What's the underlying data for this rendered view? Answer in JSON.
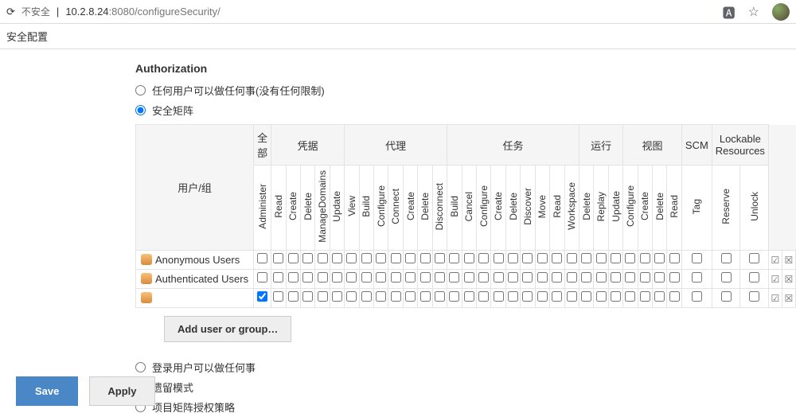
{
  "urlbar": {
    "insecure_label": "不安全",
    "host": "10.2.8.24",
    "port_path": ":8080/configureSecurity/"
  },
  "breadcrumb": {
    "page": "安全配置"
  },
  "section": {
    "authorization": "Authorization"
  },
  "auth_radios": {
    "anyone": "任何用户可以做任何事(没有任何限制)",
    "matrix": "安全矩阵",
    "logged_in": "登录用户可以做任何事",
    "legacy": "遗留模式",
    "project": "项目矩阵授权策略"
  },
  "matrix": {
    "corner_label": "用户/组",
    "groups": [
      "全部",
      "凭据",
      "代理",
      "任务",
      "运行",
      "视图",
      "SCM",
      "Lockable Resources"
    ],
    "group_spans": [
      1,
      5,
      7,
      9,
      3,
      4,
      1,
      2
    ],
    "permissions": [
      "Administer",
      "Read",
      "Create",
      "Delete",
      "ManageDomains",
      "Update",
      "View",
      "Build",
      "Configure",
      "Connect",
      "Create",
      "Delete",
      "Disconnect",
      "Build",
      "Cancel",
      "Configure",
      "Create",
      "Delete",
      "Discover",
      "Move",
      "Read",
      "Workspace",
      "Delete",
      "Replay",
      "Update",
      "Configure",
      "Create",
      "Delete",
      "Read",
      "Tag",
      "Reserve",
      "Unlock"
    ],
    "rows": [
      {
        "label": "Anonymous Users",
        "checked": []
      },
      {
        "label": "Authenticated Users",
        "checked": []
      },
      {
        "label": "",
        "checked": [
          0
        ]
      }
    ],
    "add_button": "Add user or group…"
  },
  "footer": {
    "save": "Save",
    "apply": "Apply"
  }
}
